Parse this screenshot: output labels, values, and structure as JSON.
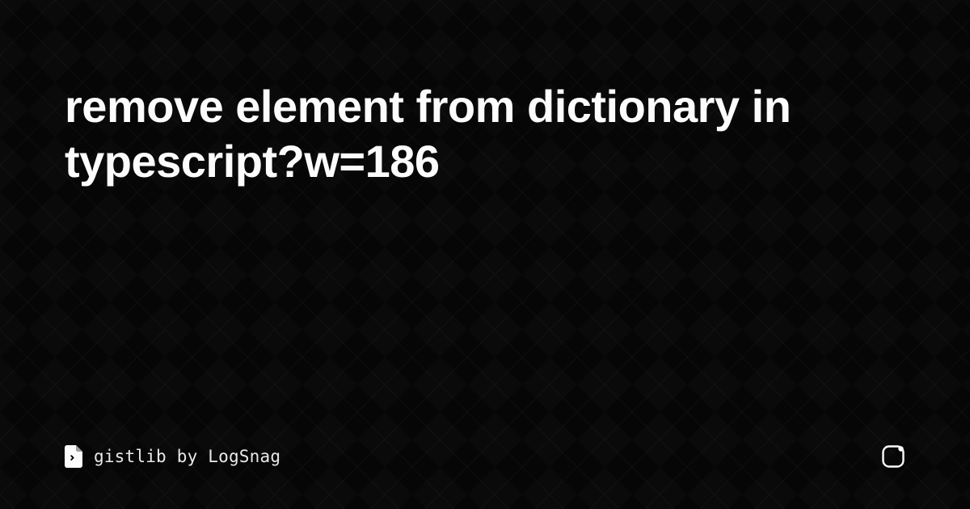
{
  "title": "remove element from dictionary in typescript?w=186",
  "brand": {
    "site": "gistlib",
    "by_label": "by",
    "author": "LogSnag",
    "full_text": "gistlib by LogSnag"
  },
  "icons": {
    "file": "file-icon",
    "share": "share-external-icon"
  },
  "colors": {
    "background": "#060606",
    "text": "#fcfcfc",
    "brand_text": "#e9e9e9"
  }
}
